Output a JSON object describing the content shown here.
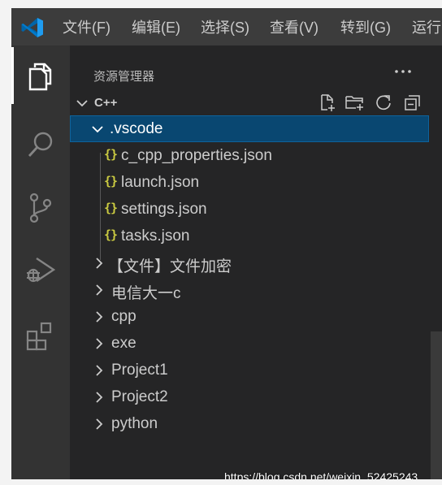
{
  "menubar": {
    "logo_icon": "vscode-logo-icon",
    "items": [
      {
        "label": "文件(F)"
      },
      {
        "label": "编辑(E)"
      },
      {
        "label": "选择(S)"
      },
      {
        "label": "查看(V)"
      },
      {
        "label": "转到(G)"
      },
      {
        "label": "运行"
      }
    ]
  },
  "activitybar": {
    "items": [
      {
        "name": "explorer",
        "icon": "files-icon",
        "active": true
      },
      {
        "name": "search",
        "icon": "search-icon",
        "active": false
      },
      {
        "name": "source-control",
        "icon": "source-control-icon",
        "active": false
      },
      {
        "name": "run-debug",
        "icon": "run-debug-icon",
        "active": false
      },
      {
        "name": "extensions",
        "icon": "extensions-icon",
        "active": false
      }
    ]
  },
  "sidebar": {
    "title": "资源管理器",
    "more_icon": "ellipsis-icon",
    "section": {
      "title": "C++",
      "actions": [
        "new-file-icon",
        "new-folder-icon",
        "refresh-icon",
        "collapse-all-icon"
      ]
    },
    "tree": [
      {
        "label": ".vscode",
        "type": "folder",
        "expanded": true,
        "selected": true,
        "depth": 0
      },
      {
        "label": "c_cpp_properties.json",
        "type": "json",
        "depth": 1
      },
      {
        "label": "launch.json",
        "type": "json",
        "depth": 1
      },
      {
        "label": "settings.json",
        "type": "json",
        "depth": 1
      },
      {
        "label": "tasks.json",
        "type": "json",
        "depth": 1
      },
      {
        "label": "【文件】文件加密",
        "type": "folder",
        "expanded": false,
        "depth": 0
      },
      {
        "label": "电信大一c",
        "type": "folder",
        "expanded": false,
        "depth": 0
      },
      {
        "label": "cpp",
        "type": "folder",
        "expanded": false,
        "depth": 0
      },
      {
        "label": "exe",
        "type": "folder",
        "expanded": false,
        "depth": 0
      },
      {
        "label": "Project1",
        "type": "folder",
        "expanded": false,
        "depth": 0
      },
      {
        "label": "Project2",
        "type": "folder",
        "expanded": false,
        "depth": 0
      },
      {
        "label": "python",
        "type": "folder",
        "expanded": false,
        "depth": 0
      }
    ],
    "json_icon_glyph": "{}"
  },
  "watermark": "https://blog.csdn.net/weixin_52425243",
  "colors": {
    "accent": "#007acc",
    "selection": "#094771",
    "selection_border": "#0e639c",
    "json_icon": "#cbcb41"
  }
}
